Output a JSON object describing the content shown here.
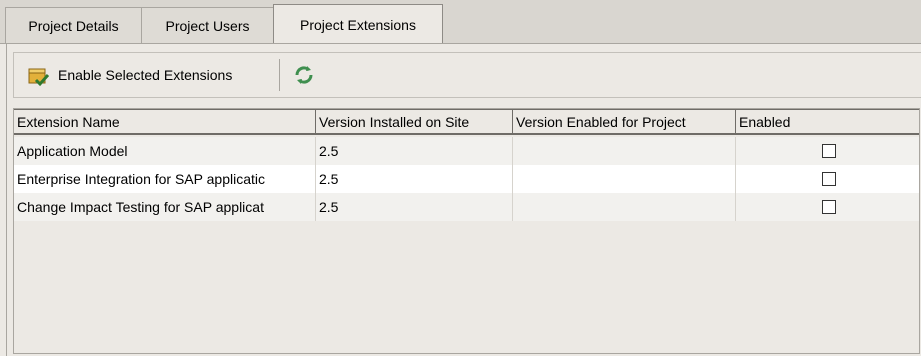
{
  "tabs": [
    {
      "label": "Project Details"
    },
    {
      "label": "Project Users"
    },
    {
      "label": "Project Extensions"
    }
  ],
  "toolbar": {
    "enable_label": "Enable Selected Extensions",
    "enable_icon": "package-enable-icon",
    "refresh_icon": "refresh-icon"
  },
  "table": {
    "columns": [
      "Extension Name",
      "Version Installed on Site",
      "Version Enabled for Project",
      "Enabled"
    ],
    "rows": [
      {
        "name": "Application Model",
        "installed": "2.5",
        "enabled_version": "",
        "enabled": false
      },
      {
        "name": "Enterprise Integration for SAP applicatic",
        "installed": "2.5",
        "enabled_version": "",
        "enabled": false
      },
      {
        "name": "Change Impact Testing for SAP applicat",
        "installed": "2.5",
        "enabled_version": "",
        "enabled": false
      }
    ]
  },
  "colors": {
    "tab_active": "#ece9e4",
    "row_alt": "#ffffff",
    "row_norm": "#f2f1ee",
    "grid": "#6f6c67"
  }
}
